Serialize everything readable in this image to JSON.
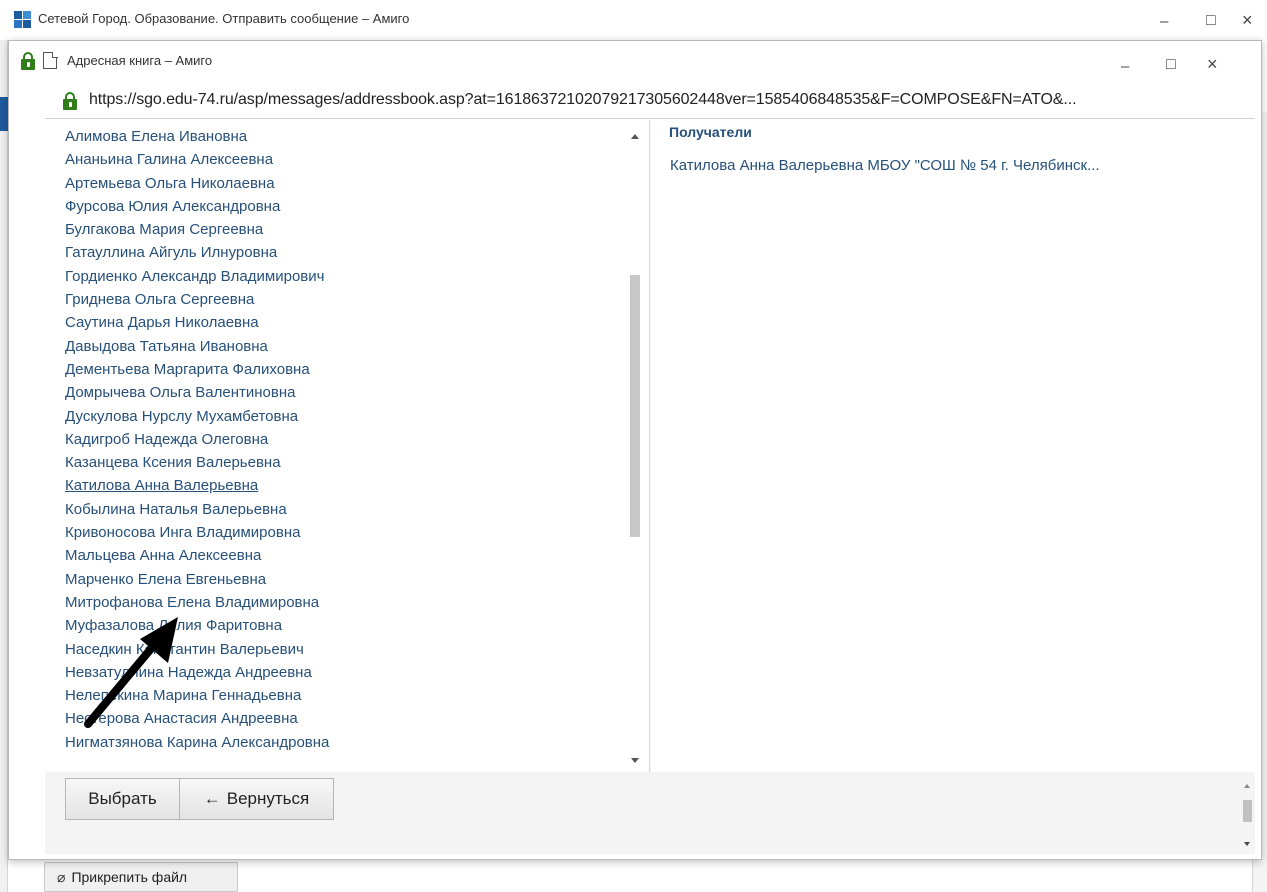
{
  "outer_window": {
    "title": "Сетевой Город. Образование. Отправить сообщение – Амиго",
    "attach_label": "Прикрепить файл"
  },
  "popup": {
    "title": "Адресная книга – Амиго",
    "url": "https://sgo.edu-74.ru/asp/messages/addressbook.asp?at=16186372102079217305602448ver=1585406848535&F=COMPOSE&FN=ATO&..."
  },
  "window_controls": {
    "minimize": "–",
    "maximize": "□",
    "close": "×"
  },
  "contacts": [
    "Алимова Елена Ивановна",
    "Ананьина Галина Алексеевна",
    "Артемьева Ольга Николаевна",
    "Фурсова Юлия Александровна",
    "Булгакова Мария Сергеевна",
    "Гатауллина Айгуль Илнуровна",
    "Гордиенко Александр Владимирович",
    "Гриднева Ольга Сергеевна",
    "Саутина Дарья Николаевна",
    "Давыдова Татьяна Ивановна",
    "Дементьева Маргарита Фалиховна",
    "Домрычева Ольга Валентиновна",
    "Дускулова Нурслу Мухамбетовна",
    "Кадигроб Надежда Олеговна",
    "Казанцева Ксения Валерьевна",
    "Катилова Анна Валерьевна",
    "Кобылина Наталья Валерьевна",
    "Кривоносова Инга Владимировна",
    "Мальцева Анна Алексеевна",
    "Марченко Елена Евгеньевна",
    "Митрофанова Елена Владимировна",
    "Муфазалова Лилия Фаритовна",
    "Наседкин Константин Валерьевич",
    "Невзатуллина Надежда Андреевна",
    "Нелепекина Марина Геннадьевна",
    "Нестерова Анастасия Андреевна",
    "Нигматзянова Карина Александровна"
  ],
  "hovered_contact_index": 15,
  "recipients": {
    "heading": "Получатели",
    "items": [
      "Катилова Анна Валерьевна МБОУ \"СОШ № 54 г. Челябинск..."
    ]
  },
  "buttons": {
    "select": "Выбрать",
    "back": "Вернуться"
  },
  "icons": {
    "lock": "lock-icon",
    "page": "page-icon",
    "back_arrow": "left-arrow-icon",
    "paperclip": "paperclip-icon",
    "annotation": "pointer-arrow"
  },
  "colors": {
    "link": "#27507a",
    "lock_green": "#2f7d1b",
    "app_blue": "#1e5a9e",
    "annotation_arrow": "#000000"
  }
}
